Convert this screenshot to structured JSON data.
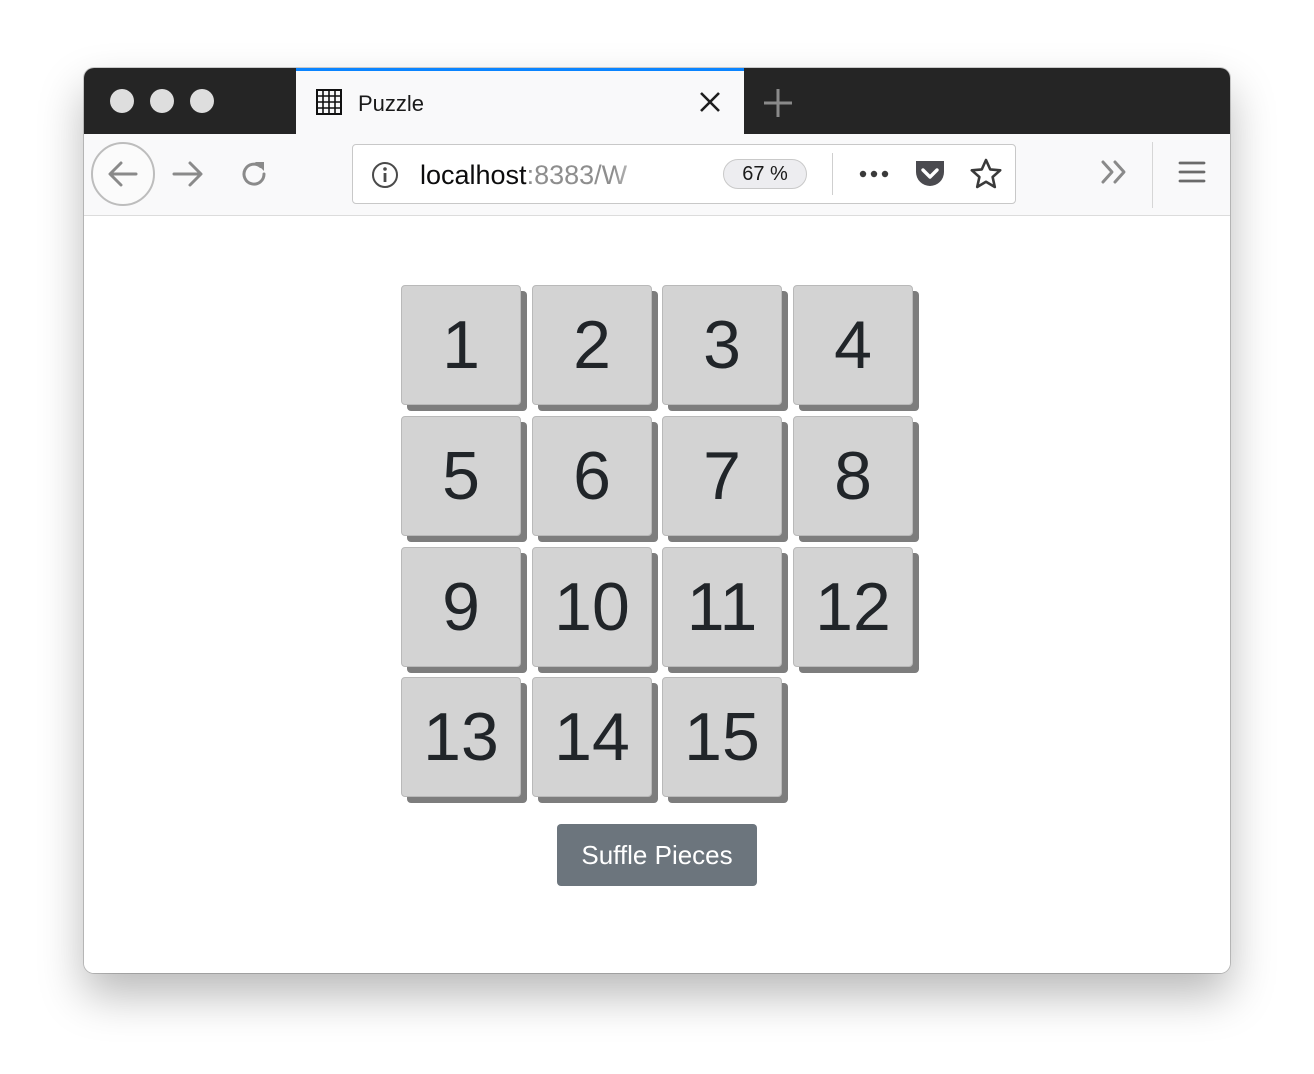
{
  "browser": {
    "tab": {
      "title": "Puzzle",
      "favicon": "grid-icon"
    },
    "address": {
      "host": "localhost",
      "rest": ":8383/W",
      "zoom": "67 %"
    }
  },
  "puzzle": {
    "tiles": [
      "1",
      "2",
      "3",
      "4",
      "5",
      "6",
      "7",
      "8",
      "9",
      "10",
      "11",
      "12",
      "13",
      "14",
      "15",
      ""
    ],
    "shuffle_label": "Suffle Pieces"
  },
  "colors": {
    "tab_accent": "#0a84ff",
    "tile_bg": "#d3d3d3",
    "tile_shadow": "#7d7d7d",
    "button_bg": "#6c757d"
  }
}
